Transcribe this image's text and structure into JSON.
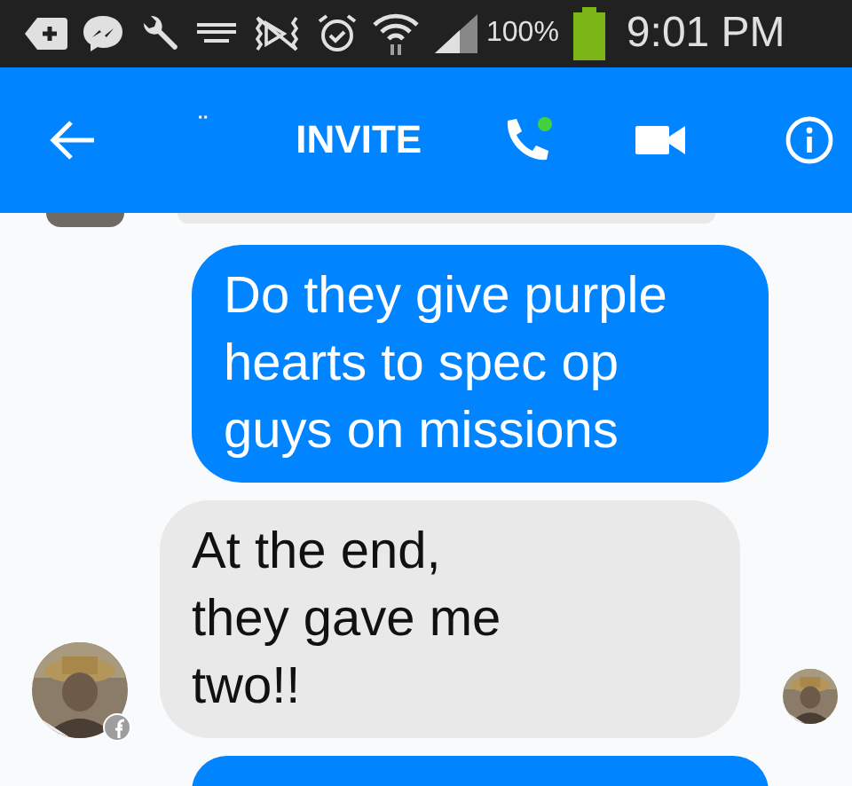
{
  "status_bar": {
    "battery_text": "100%",
    "time": "9:01 PM"
  },
  "header": {
    "title": "¨",
    "invite": "INVITE",
    "call_online": true
  },
  "messages": [
    {
      "kind": "incoming_cut"
    },
    {
      "kind": "outgoing",
      "text": "Do they give purple\nhearts to spec op\nguys on missions"
    },
    {
      "kind": "incoming",
      "text": "At the end,\nthey gave me\ntwo!!",
      "seen": true
    },
    {
      "kind": "outgoing_cut"
    }
  ]
}
